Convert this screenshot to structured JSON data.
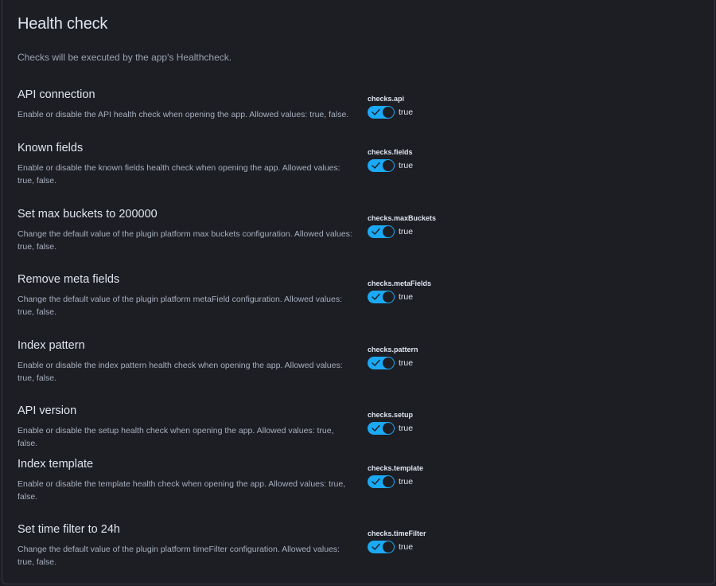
{
  "panel": {
    "title": "Health check",
    "description": "Checks will be executed by the app's Healthcheck."
  },
  "settings": [
    {
      "name": "API connection",
      "description": "Enable or disable the API health check when opening the app. Allowed values: true, false.",
      "key": "checks.api",
      "value_label": "true",
      "checked": true
    },
    {
      "name": "Known fields",
      "description": "Enable or disable the known fields health check when opening the app. Allowed values: true, false.",
      "key": "checks.fields",
      "value_label": "true",
      "checked": true
    },
    {
      "name": "Set max buckets to 200000",
      "description": "Change the default value of the plugin platform max buckets configuration. Allowed values: true, false.",
      "key": "checks.maxBuckets",
      "value_label": "true",
      "checked": true
    },
    {
      "name": "Remove meta fields",
      "description": "Change the default value of the plugin platform metaField configuration. Allowed values: true, false.",
      "key": "checks.metaFields",
      "value_label": "true",
      "checked": true
    },
    {
      "name": "Index pattern",
      "description": "Enable or disable the index pattern health check when opening the app. Allowed values: true, false.",
      "key": "checks.pattern",
      "value_label": "true",
      "checked": true
    },
    {
      "name": "API version",
      "description": "Enable or disable the setup health check when opening the app. Allowed values: true, false.",
      "key": "checks.setup",
      "value_label": "true",
      "checked": true
    },
    {
      "name": "Index template",
      "description": "Enable or disable the template health check when opening the app. Allowed values: true, false.",
      "key": "checks.template",
      "value_label": "true",
      "checked": true
    },
    {
      "name": "Set time filter to 24h",
      "description": "Change the default value of the plugin platform timeFilter configuration. Allowed values: true, false.",
      "key": "checks.timeFilter",
      "value_label": "true",
      "checked": true
    }
  ],
  "colors": {
    "background": "#1d1e24",
    "switch_on": "#1ba9f5",
    "text_primary": "#dfe5ef",
    "text_secondary": "#a7afbe"
  },
  "icons": {
    "switch_check": "check-icon"
  }
}
